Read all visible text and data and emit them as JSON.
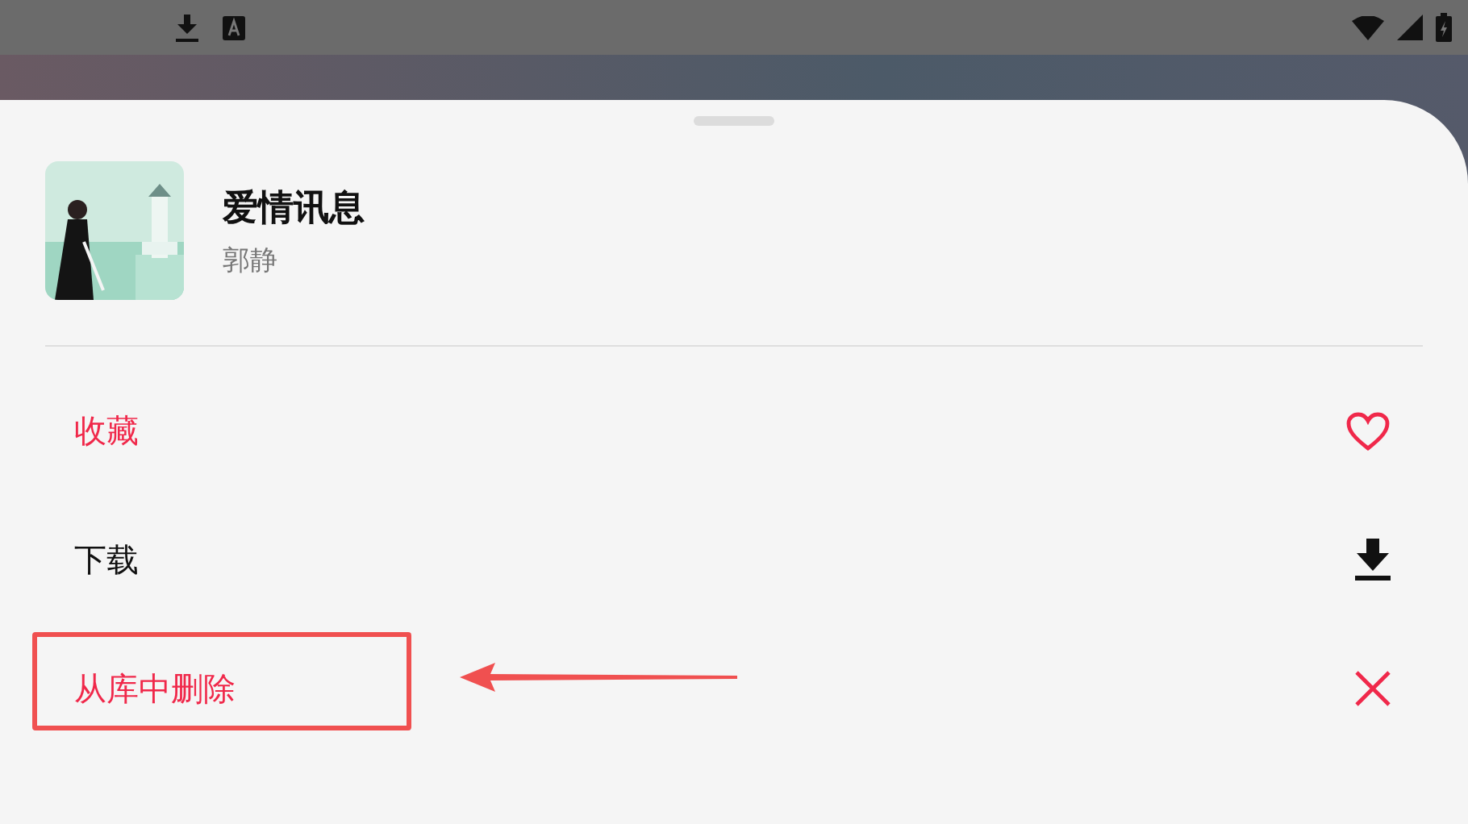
{
  "sheet": {
    "song": {
      "title": "爱情讯息",
      "artist": "郭静"
    },
    "actions": [
      {
        "label": "收藏",
        "kind": "heart",
        "destructive": true,
        "highlighted": false
      },
      {
        "label": "下载",
        "kind": "download",
        "destructive": false,
        "highlighted": false
      },
      {
        "label": "从库中删除",
        "kind": "close",
        "destructive": true,
        "highlighted": true
      }
    ]
  }
}
